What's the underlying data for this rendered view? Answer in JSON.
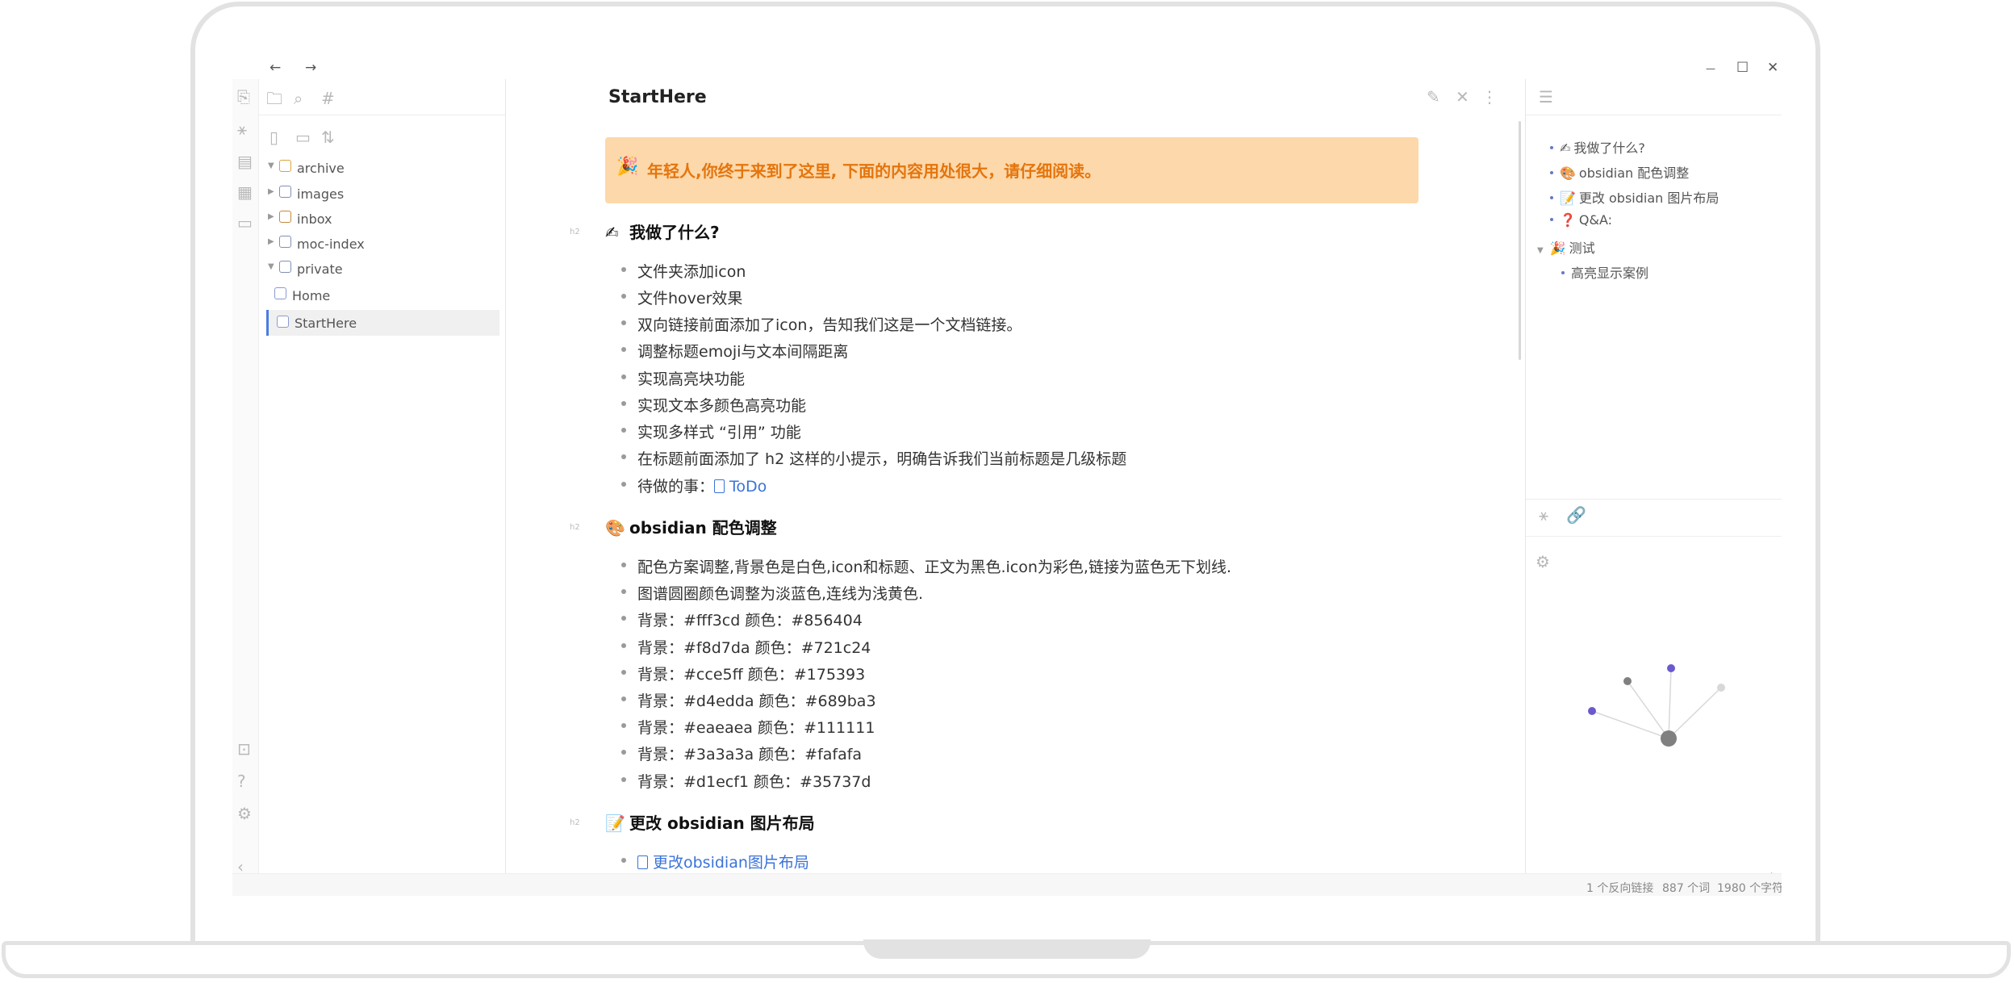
{
  "titlebar": {
    "back": "←",
    "forward": "→",
    "minimize": "—",
    "maximize": "☐",
    "close": "✕"
  },
  "sidebar": {
    "items": [
      {
        "label": "archive",
        "arrow": "▼"
      },
      {
        "label": "images",
        "arrow": "▶"
      },
      {
        "label": "inbox",
        "arrow": "▶"
      },
      {
        "label": "moc-index",
        "arrow": "▶"
      },
      {
        "label": "private",
        "arrow": "▼"
      },
      {
        "label": "Home",
        "arrow": ""
      },
      {
        "label": "StartHere",
        "arrow": ""
      }
    ]
  },
  "editor": {
    "title": "StartHere",
    "banner": "年轻人,你终于来到了这里, 下面的内容用处很大，请仔细阅读。",
    "h2_tag": "h2",
    "section1": {
      "heading": "我做了什么?",
      "items": [
        "文件夹添加icon",
        "文件hover效果",
        "双向链接前面添加了icon，告知我们这是一个文档链接。",
        "调整标题emoji与文本间隔距离",
        "实现高亮块功能",
        "实现文本多颜色高亮功能",
        "实现多样式 “引用” 功能",
        "在标题前面添加了 h2 这样的小提示，明确告诉我们当前标题是几级标题"
      ],
      "todo_prefix": "待做的事：",
      "todo_link": "ToDo"
    },
    "section2": {
      "heading": "obsidian 配色调整",
      "items": [
        "配色方案调整,背景色是白色,icon和标题、正文为黑色.icon为彩色,链接为蓝色无下划线.",
        "图谱圆圈颜色调整为淡蓝色,连线为浅黄色.",
        "背景：#fff3cd 颜色：#856404",
        "背景：#f8d7da 颜色：#721c24",
        "背景：#cce5ff 颜色：#175393",
        "背景：#d4edda 颜色：#689ba3",
        "背景：#eaeaea 颜色：#111111",
        "背景：#3a3a3a 颜色：#fafafa",
        "背景：#d1ecf1 颜色：#35737d"
      ]
    },
    "section3": {
      "heading": "更改 obsidian 图片布局",
      "link": "更改obsidian图片布局"
    }
  },
  "outline": {
    "items": [
      "我做了什么?",
      "obsidian 配色调整",
      "更改 obsidian 图片布局",
      "Q&A:",
      "测试",
      "高亮显示案例"
    ]
  },
  "status": {
    "backlinks": "1 个反向链接",
    "words": "887 个词",
    "chars": "1980 个字符"
  },
  "colors": {
    "banner_bg": "#fdd8aa",
    "banner_text": "#e4750d",
    "link": "#3a73d9",
    "accent": "#6678c6"
  }
}
